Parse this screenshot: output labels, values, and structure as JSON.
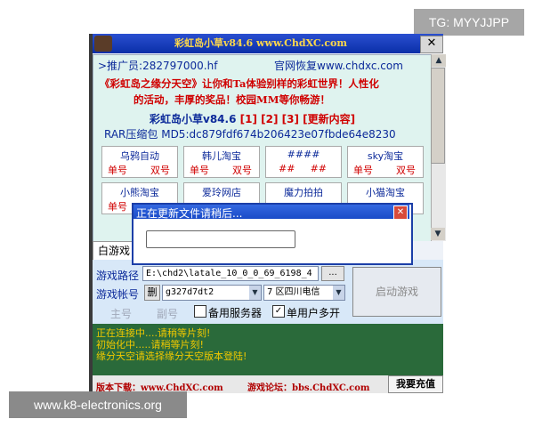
{
  "watermarks": {
    "top_right": "TG: MYYJJPP",
    "bottom_left": "www.k8-electronics.org"
  },
  "window": {
    "title": "彩虹岛小草v84.6 www.ChdXC.com",
    "close_glyph": "✕"
  },
  "info": {
    "referrer": ">推广员:282797000.hf",
    "official": "官网恢复www.chdxc.com",
    "promo_line1": "《彩虹岛之缘分天空》让你和Ta体验别样的彩虹世界！人性化",
    "promo_line2": "的活动，丰厚的奖品！校园MM等你畅游！",
    "version_prefix": "彩虹岛小草v84.6",
    "links": [
      "[1]",
      "[2]",
      "[3]",
      "[更新内容]"
    ],
    "md5": "RAR压缩包  MD5:dc879fdf674b206423e07fbde64e8230"
  },
  "shops": [
    {
      "name": "乌鸦自动",
      "a": "单号",
      "b": "双号"
    },
    {
      "name": "韩儿淘宝",
      "a": "单号",
      "b": "双号"
    },
    {
      "name": "####",
      "a": "##",
      "b": "##"
    },
    {
      "name": "sky淘宝",
      "a": "单号",
      "b": "双号"
    },
    {
      "name": "小熊淘宝",
      "a": "单号",
      "b": ""
    },
    {
      "name": "爱玲网店",
      "a": "",
      "b": ""
    },
    {
      "name": "魔力拍拍",
      "a": "",
      "b": ""
    },
    {
      "name": "小猫淘宝",
      "a": "",
      "b": ""
    }
  ],
  "tab": {
    "label": "白游戏"
  },
  "form": {
    "path_label": "游戏路径",
    "path_value": "E:\\chd2\\latale_10_0_0_69_6198_4",
    "browse_label": "...",
    "account_label": "游戏帐号",
    "delete_label": "删",
    "account_value": "g327d7dt2",
    "server_value": "7 区四川电信",
    "start_label": "启动游戏",
    "main_label": "主号",
    "sub_label": "副号",
    "backup_label": "备用服务器",
    "multi_label": "单用户多开",
    "backup_checked": false,
    "multi_checked": true
  },
  "log": {
    "lines": [
      "正在连接中....请稍等片刻!",
      "初始化中.....请稍等片刻!",
      "缘分天空请选择缘分天空版本登陆!"
    ]
  },
  "footer": {
    "download": "版本下载：www.ChdXC.com",
    "forum": "游戏论坛：bbs.ChdXC.com",
    "recharge": "我要充值"
  },
  "dialog": {
    "title": "正在更新文件请稍后...",
    "close_glyph": "✕",
    "progress": 0
  },
  "colors": {
    "title_blue": "#0a2fa8",
    "promo_red": "#d00000",
    "text_blue": "#0c2a9a",
    "log_bg": "#2a6a3a",
    "log_text": "#f0c800"
  }
}
